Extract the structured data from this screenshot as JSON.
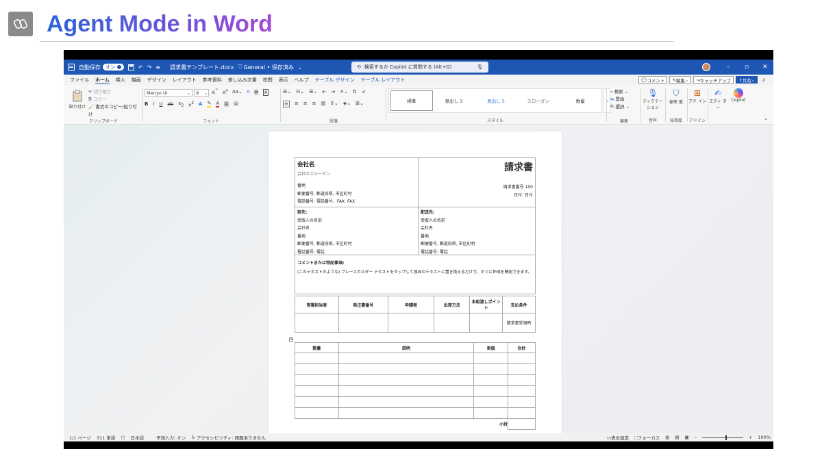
{
  "slide": {
    "title": "Agent Mode in Word"
  },
  "titlebar": {
    "autosave_label": "自動保存",
    "autosave_toggle": "オン",
    "filename": "請求書テンプレート.docx",
    "sensitivity": "General • 保存済み",
    "search_placeholder": "検索するか Copilot に質問する (Alt+Q)"
  },
  "menu": {
    "items": [
      "ファイル",
      "ホーム",
      "挿入",
      "描画",
      "デザイン",
      "レイアウト",
      "参考資料",
      "差し込み文書",
      "校閲",
      "表示",
      "ヘルプ",
      "テーブル デザイン",
      "テーブル レイアウト"
    ],
    "comment": "コメント",
    "edit": "編集",
    "catchup": "キャッチアップ",
    "share": "共有"
  },
  "ribbon": {
    "clipboard": {
      "paste": "貼り付け",
      "cut": "切り取り",
      "copy": "コピー",
      "format_painter": "書式のコピー/貼り付け",
      "label": "クリップボード"
    },
    "font": {
      "name": "Meiryo UI",
      "size": "9",
      "label": "フォント"
    },
    "paragraph": {
      "label": "段落"
    },
    "styles": {
      "items": [
        "標準",
        "見出し 3",
        "見出し 5",
        "スローガン",
        "数量"
      ],
      "label": "スタイル"
    },
    "editing": {
      "find": "検索",
      "replace": "置換",
      "select": "選択",
      "label": "編集"
    },
    "voice": {
      "dictate": "ディクテー ション",
      "label": "音声"
    },
    "sensitivity": {
      "btn": "秘密 度",
      "label": "秘密度"
    },
    "addins": {
      "btn": "アド イン",
      "label": "アドイン"
    },
    "editor": {
      "btn": "エディ ター"
    },
    "copilot": {
      "btn": "Copilot"
    }
  },
  "document": {
    "company_name": "会社名",
    "slogan": "会社のスローガン",
    "title": "請求書",
    "address": "番地",
    "postal_line": "郵便番号, 都道府県, 市区町村",
    "phone_line": "電話番号: 電話番号、FAX: FAX",
    "invoice_no": "請求書番号 100",
    "date": "日付: 日付",
    "bill_to": {
      "heading": "宛先:",
      "recipient": "受取人の名前",
      "company": "会社名",
      "address": "番地",
      "postal": "郵便番号, 都道府県, 市区町村",
      "phone": "電話番号: 電話"
    },
    "ship_to": {
      "heading": "配送先:",
      "recipient": "受取人の名前",
      "company": "会社名",
      "address": "番地",
      "postal": "郵便番号, 都道府県, 市区町村",
      "phone": "電話番号: 電話"
    },
    "comments_heading": "コメントまたは特記事項:",
    "comments_body": "(このテキストのような) プレースホルダー テキストをタップして独自のテキストに置き換えるだけで、すぐに作成を開始できます。",
    "order_table": {
      "headers": [
        "営業担当者",
        "発注書番号",
        "申請者",
        "出荷方法",
        "本船渡しポイント",
        "支払条件"
      ],
      "terms_value": "請求書受領時"
    },
    "items_table": {
      "headers": [
        "数量",
        "説明",
        "単価",
        "合計"
      ],
      "subtotal": "小計"
    }
  },
  "statusbar": {
    "page": "1/1 ページ",
    "words": "311 単語",
    "language": "日本語",
    "prediction": "予測入力: オン",
    "accessibility": "アクセシビリティ: 問題ありません",
    "display_settings": "表示設定",
    "focus": "フォーカス",
    "zoom": "100%"
  }
}
